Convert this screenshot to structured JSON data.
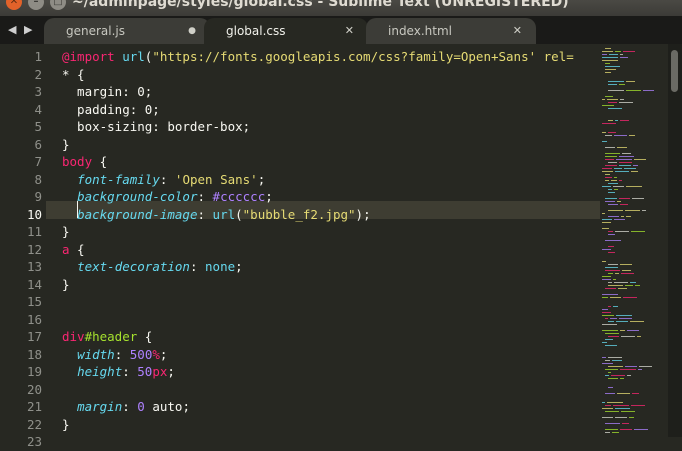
{
  "window": {
    "title": "~/adminpage/styles/global.css - Sublime Text (UNREGISTERED)",
    "close_glyph": "✕",
    "min_glyph": "–",
    "max_glyph": "□"
  },
  "tabs": [
    {
      "label": "general.js",
      "icon": "●",
      "icon_name": "modified-dot-icon",
      "active": false
    },
    {
      "label": "global.css",
      "icon": "✕",
      "icon_name": "close-icon",
      "active": true
    },
    {
      "label": "index.html",
      "icon": "✕",
      "icon_name": "close-icon",
      "active": false
    }
  ],
  "nav": {
    "left": "◀",
    "right": "▶"
  },
  "editor": {
    "line_numbers": [
      "1",
      "2",
      "3",
      "4",
      "5",
      "6",
      "7",
      "8",
      "9",
      "10",
      "11",
      "12",
      "13",
      "14",
      "15",
      "16",
      "17",
      "18",
      "19",
      "20",
      "21",
      "22",
      "23"
    ],
    "current_line": "10",
    "lines": [
      {
        "segs": [
          [
            "@import",
            "kw"
          ],
          [
            " ",
            "white"
          ],
          [
            "url",
            "fn"
          ],
          [
            "(",
            "white"
          ],
          [
            "\"https://fonts.googleapis.com/css?family=Open+Sans' rel=",
            "str"
          ]
        ]
      },
      {
        "segs": [
          [
            "* {",
            "white"
          ]
        ]
      },
      {
        "segs": [
          [
            "  margin: 0;",
            "white"
          ]
        ]
      },
      {
        "segs": [
          [
            "  padding: 0;",
            "white"
          ]
        ]
      },
      {
        "segs": [
          [
            "  box-sizing: border-box;",
            "white"
          ]
        ]
      },
      {
        "segs": [
          [
            "}",
            "white"
          ]
        ]
      },
      {
        "segs": [
          [
            "body",
            "tag"
          ],
          [
            " {",
            "white"
          ]
        ]
      },
      {
        "segs": [
          [
            "  ",
            "white"
          ],
          [
            "font-family",
            "prop"
          ],
          [
            ": ",
            "white"
          ],
          [
            "'Open Sans'",
            "str"
          ],
          [
            ";",
            "white"
          ]
        ]
      },
      {
        "segs": [
          [
            "  ",
            "white"
          ],
          [
            "background-color",
            "prop"
          ],
          [
            ": ",
            "white"
          ],
          [
            "#cccccc",
            "num"
          ],
          [
            ";",
            "white"
          ]
        ]
      },
      {
        "segs": [
          [
            "  ",
            "white"
          ],
          [
            "background-image",
            "prop"
          ],
          [
            ": ",
            "white"
          ],
          [
            "url",
            "fn"
          ],
          [
            "(",
            "white"
          ],
          [
            "\"bubble_f2.jpg\"",
            "str"
          ],
          [
            ");",
            "white"
          ]
        ]
      },
      {
        "segs": [
          [
            "}",
            "white"
          ]
        ]
      },
      {
        "segs": [
          [
            "a",
            "tag"
          ],
          [
            " {",
            "white"
          ]
        ]
      },
      {
        "segs": [
          [
            "  ",
            "white"
          ],
          [
            "text-decoration",
            "prop"
          ],
          [
            ": ",
            "white"
          ],
          [
            "none",
            "fn"
          ],
          [
            ";",
            "white"
          ]
        ]
      },
      {
        "segs": [
          [
            "}",
            "white"
          ]
        ]
      },
      {
        "segs": []
      },
      {
        "segs": []
      },
      {
        "segs": [
          [
            "div",
            "tag"
          ],
          [
            "#header",
            "cls"
          ],
          [
            " {",
            "white"
          ]
        ]
      },
      {
        "segs": [
          [
            "  ",
            "white"
          ],
          [
            "width",
            "prop"
          ],
          [
            ": ",
            "white"
          ],
          [
            "500",
            "num"
          ],
          [
            "%",
            "kw"
          ],
          [
            ";",
            "white"
          ]
        ]
      },
      {
        "segs": [
          [
            "  ",
            "white"
          ],
          [
            "height",
            "prop"
          ],
          [
            ": ",
            "white"
          ],
          [
            "50",
            "num"
          ],
          [
            "px",
            "kw"
          ],
          [
            ";",
            "white"
          ]
        ]
      },
      {
        "segs": []
      },
      {
        "segs": [
          [
            "  ",
            "white"
          ],
          [
            "margin",
            "prop"
          ],
          [
            ": ",
            "white"
          ],
          [
            "0",
            "num"
          ],
          [
            " auto;",
            "white"
          ]
        ]
      },
      {
        "segs": [
          [
            "}",
            "white"
          ]
        ]
      },
      {
        "segs": []
      }
    ]
  },
  "colors": {
    "background": "#272822",
    "keyword": "#f92672",
    "function": "#66d9ef",
    "string": "#e6db74",
    "number": "#ae81ff",
    "class": "#a6e22e"
  }
}
